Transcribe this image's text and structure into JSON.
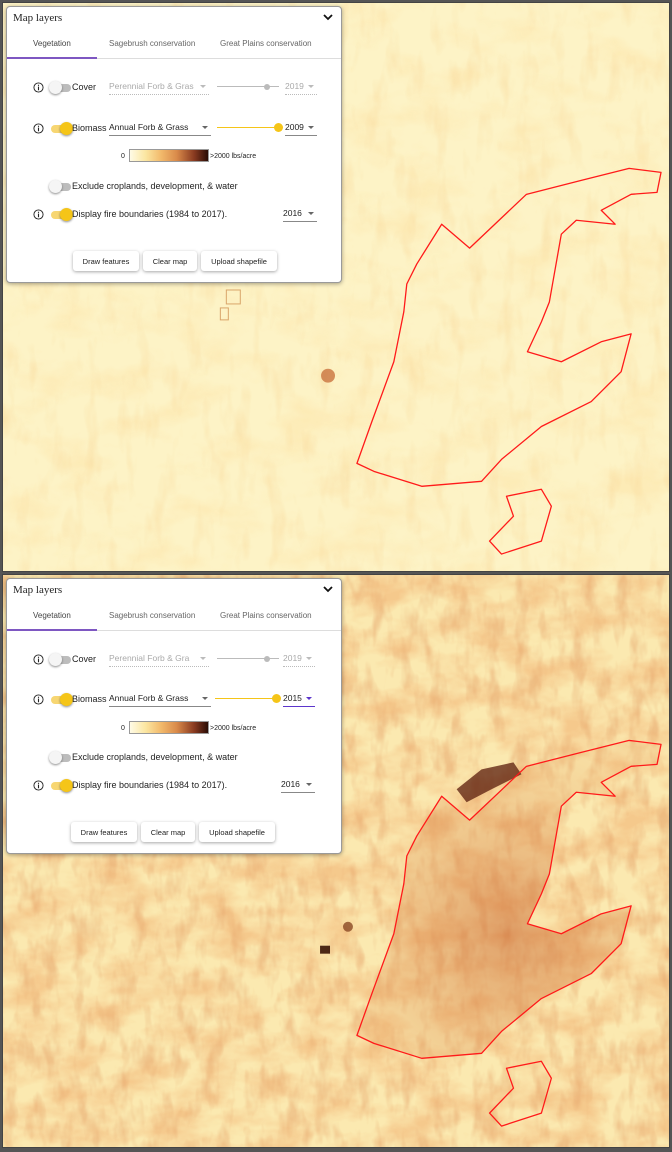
{
  "panels": [
    {
      "title": "Map layers",
      "tabs": [
        "Vegetation",
        "Sagebrush conservation",
        "Great Plains conservation"
      ],
      "cover": {
        "label": "Cover",
        "select": "Perennial Forb & Gras",
        "year": "2019",
        "enabled": false
      },
      "biomass": {
        "label": "Biomass",
        "select": "Annual Forb & Grass",
        "year": "2009",
        "enabled": true
      },
      "legend": {
        "min": "0",
        "max": ">2000 lbs/acre"
      },
      "exclude_label": "Exclude croplands, development, & water",
      "fire": {
        "label": "Display fire boundaries (1984 to 2017).",
        "year": "2016",
        "enabled": true
      },
      "buttons": [
        "Draw features",
        "Clear map",
        "Upload shapefile"
      ]
    },
    {
      "title": "Map layers",
      "tabs": [
        "Vegetation",
        "Sagebrush conservation",
        "Great Plains conservation"
      ],
      "cover": {
        "label": "Cover",
        "select": "Perennial Forb & Gra",
        "year": "2019",
        "enabled": false
      },
      "biomass": {
        "label": "Biomass",
        "select": "Annual Forb & Grass",
        "year": "2015",
        "enabled": true
      },
      "legend": {
        "min": "0",
        "max": ">2000 lbs/acre"
      },
      "exclude_label": "Exclude croplands, development, & water",
      "fire": {
        "label": "Display fire boundaries (1984 to 2017).",
        "year": "2016",
        "enabled": true
      },
      "buttons": [
        "Draw features",
        "Clear map",
        "Upload shapefile"
      ]
    }
  ],
  "colors": {
    "accent": "#7e57c2",
    "toggle_on": "#f5c518",
    "fire_boundary": "#ff1a1a",
    "map_light": "#fdf3c4",
    "map_dark": "#b8552a"
  },
  "icons": [
    "info-icon",
    "chevron-down-icon",
    "dropdown-caret-icon"
  ]
}
